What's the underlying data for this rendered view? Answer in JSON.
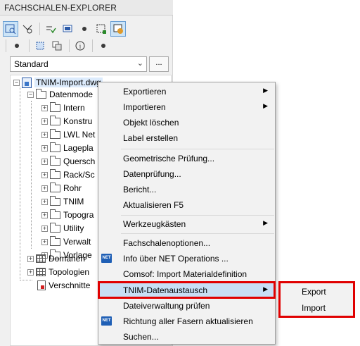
{
  "panel": {
    "title": "FACHSCHALEN-EXPLORER",
    "combo_value": "Standard",
    "combo_button": "..."
  },
  "toolbar_icons": [
    "explorer-view-icon",
    "filter-icon",
    "connect-icon",
    "screen-icon",
    "dot-icon",
    "grid-select-icon",
    "database-icon",
    "dot-icon",
    "layer-icon",
    "copy-icon",
    "info-icon",
    "dot-icon"
  ],
  "tree": {
    "root": "TNIM-Import.dwg",
    "datenmodell": "Datenmode",
    "folders": [
      "Intern",
      "Konstru",
      "LWL Net",
      "Lagepla",
      "Quersch",
      "Rack/Sc",
      "Rohr",
      "TNIM",
      "Topogra",
      "Utility",
      "Verwalt",
      "Vorlage"
    ],
    "domaenen": "Domänen",
    "topologien": "Topologien",
    "verschnitte": "Verschnitte"
  },
  "menu": {
    "items": [
      {
        "label": "Exportieren",
        "submenu": true
      },
      {
        "label": "Importieren",
        "submenu": true
      },
      {
        "label": "Objekt löschen"
      },
      {
        "label": "Label erstellen"
      },
      {
        "label": "Geometrische Prüfung..."
      },
      {
        "label": "Datenprüfung..."
      },
      {
        "label": "Bericht..."
      },
      {
        "label": "Aktualisieren F5"
      },
      {
        "label": "Werkzeugkästen",
        "submenu": true
      },
      {
        "label": "Fachschalenoptionen..."
      },
      {
        "label": "Info über NET Operations ...",
        "icon": "NET"
      },
      {
        "label": "Comsof: Import Materialdefinition"
      },
      {
        "label": "TNIM-Datenaustausch",
        "submenu": true,
        "highlighted": true
      },
      {
        "label": "Dateiverwaltung prüfen"
      },
      {
        "label": "Richtung aller Fasern aktualisieren",
        "icon": "NET"
      },
      {
        "label": "Suchen..."
      }
    ],
    "net_badge": "NET"
  },
  "submenu": {
    "items": [
      "Export",
      "Import"
    ]
  },
  "colors": {
    "highlight_border": "#e00000",
    "menu_highlight": "#c8dff5",
    "net_icon": "#1f5fb5"
  }
}
